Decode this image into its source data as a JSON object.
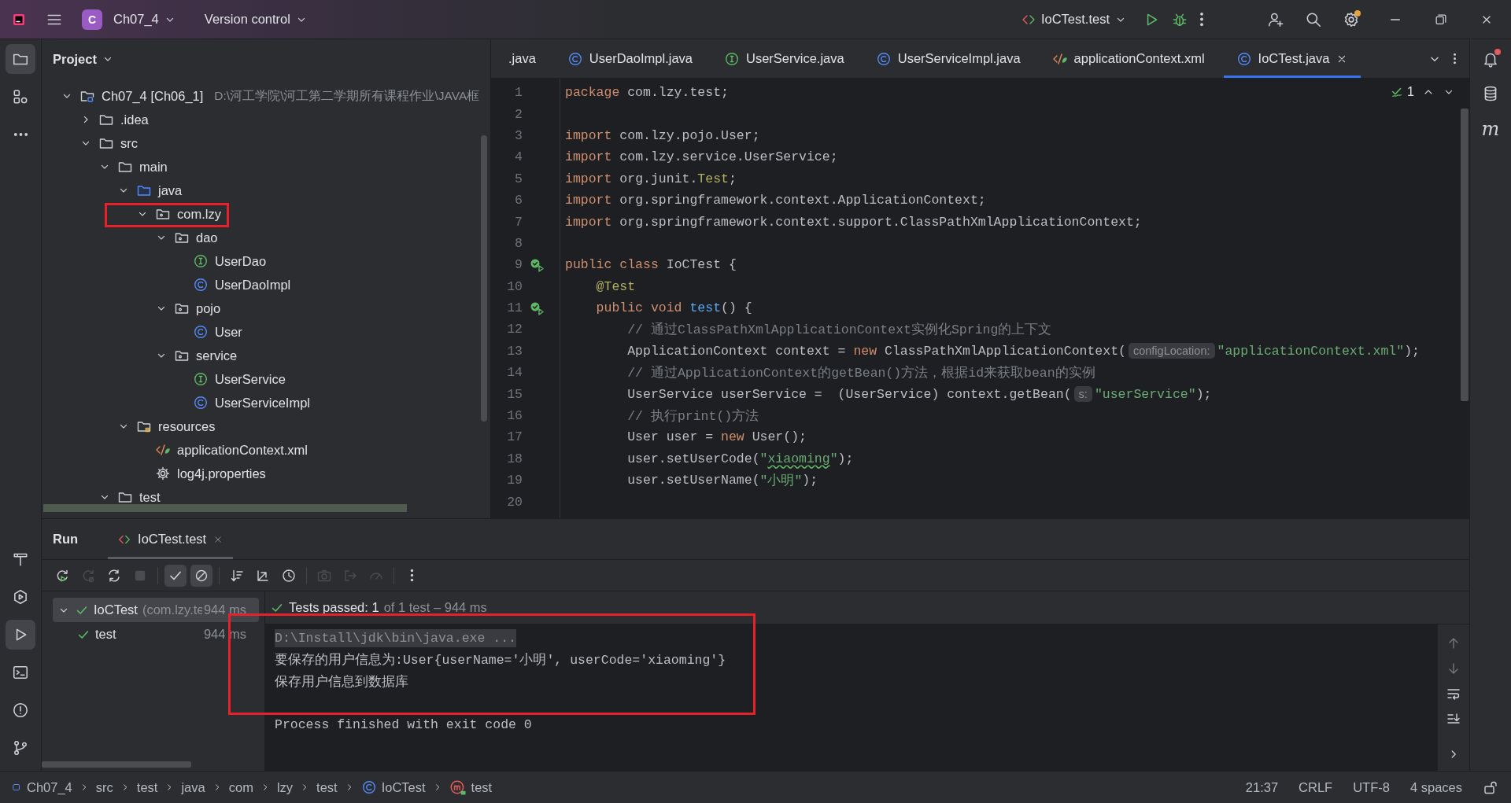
{
  "title_bar": {
    "project_badge": "C",
    "project": "Ch07_4",
    "vcs": "Version control",
    "run_config": "IoCTest.test",
    "settings_update": true
  },
  "left_toolbar": {
    "top_buttons": [
      {
        "selected": true
      },
      {
        "selected": false
      },
      {
        "selected": false
      }
    ],
    "bottom_buttons": [
      {
        "selected": false
      },
      {
        "selected": false
      },
      {
        "selected": true
      },
      {
        "selected": false
      },
      {
        "selected": false
      },
      {
        "selected": false
      }
    ]
  },
  "right_toolbar": {
    "notifications_unread": true,
    "maven_label": "m"
  },
  "project_panel": {
    "title": "Project",
    "tree": [
      {
        "label": "Ch07_4 [Ch06_1]",
        "path": "D:\\河工学院\\河工第二学期所有课程作业\\JAVA框",
        "kind": "module",
        "expanded": true,
        "highlighted": false,
        "children": [
          {
            "label": ".idea",
            "kind": "folder",
            "expanded": false,
            "highlighted": false
          },
          {
            "label": "src",
            "kind": "folder",
            "expanded": true,
            "highlighted": false,
            "children": [
              {
                "label": "main",
                "kind": "folder",
                "expanded": true,
                "highlighted": false,
                "children": [
                  {
                    "label": "java",
                    "kind": "source",
                    "expanded": true,
                    "highlighted": false,
                    "children": [
                      {
                        "label": "com.lzy",
                        "kind": "package",
                        "expanded": true,
                        "highlighted": true,
                        "children": [
                          {
                            "label": "dao",
                            "kind": "package",
                            "expanded": true,
                            "highlighted": false,
                            "children": [
                              {
                                "label": "UserDao",
                                "kind": "interface",
                                "highlighted": false
                              },
                              {
                                "label": "UserDaoImpl",
                                "kind": "class",
                                "highlighted": false
                              }
                            ]
                          },
                          {
                            "label": "pojo",
                            "kind": "package",
                            "expanded": true,
                            "highlighted": false,
                            "children": [
                              {
                                "label": "User",
                                "kind": "class",
                                "highlighted": false
                              }
                            ]
                          },
                          {
                            "label": "service",
                            "kind": "package",
                            "expanded": true,
                            "highlighted": false,
                            "children": [
                              {
                                "label": "UserService",
                                "kind": "interface",
                                "highlighted": false
                              },
                              {
                                "label": "UserServiceImpl",
                                "kind": "class",
                                "highlighted": false
                              }
                            ]
                          }
                        ]
                      }
                    ]
                  },
                  {
                    "label": "resources",
                    "kind": "resources",
                    "expanded": true,
                    "highlighted": false,
                    "children": [
                      {
                        "label": "applicationContext.xml",
                        "kind": "xml",
                        "highlighted": false
                      },
                      {
                        "label": "log4j.properties",
                        "kind": "properties",
                        "highlighted": false
                      }
                    ]
                  }
                ]
              },
              {
                "label": "test",
                "kind": "folder",
                "expanded": true,
                "highlighted": false
              }
            ]
          }
        ]
      }
    ]
  },
  "editor": {
    "tabs": [
      {
        "label": ".java",
        "kind": "none",
        "selected": false
      },
      {
        "label": "UserDaoImpl.java",
        "kind": "class",
        "selected": false
      },
      {
        "label": "UserService.java",
        "kind": "interface",
        "selected": false
      },
      {
        "label": "UserServiceImpl.java",
        "kind": "class",
        "selected": false
      },
      {
        "label": "applicationContext.xml",
        "kind": "xml",
        "selected": false
      },
      {
        "label": "IoCTest.java",
        "kind": "class",
        "selected": true
      }
    ],
    "inspection_count": "1",
    "lines": [
      {
        "number": "1",
        "run_marker": false,
        "tokens": [
          {
            "kind": "keyword",
            "text": "package"
          },
          {
            "kind": "plain",
            "text": " com.lzy.test;"
          }
        ]
      },
      {
        "number": "2",
        "run_marker": false
      },
      {
        "number": "3",
        "run_marker": false,
        "tokens": [
          {
            "kind": "keyword",
            "text": "import"
          },
          {
            "kind": "plain",
            "text": " com.lzy.pojo.User;"
          }
        ]
      },
      {
        "number": "4",
        "run_marker": false,
        "tokens": [
          {
            "kind": "keyword",
            "text": "import"
          },
          {
            "kind": "plain",
            "text": " com.lzy.service.UserService;"
          }
        ]
      },
      {
        "number": "5",
        "run_marker": false,
        "tokens": [
          {
            "kind": "keyword",
            "text": "import"
          },
          {
            "kind": "plain",
            "text": " org.junit."
          },
          {
            "kind": "annotation",
            "text": "Test"
          },
          {
            "kind": "plain",
            "text": ";"
          }
        ]
      },
      {
        "number": "6",
        "run_marker": false,
        "tokens": [
          {
            "kind": "keyword",
            "text": "import"
          },
          {
            "kind": "plain",
            "text": " org.springframework.context.ApplicationContext;"
          }
        ]
      },
      {
        "number": "7",
        "run_marker": false,
        "tokens": [
          {
            "kind": "keyword",
            "text": "import"
          },
          {
            "kind": "plain",
            "text": " org.springframework.context.support.ClassPathXmlApplicationContext;"
          }
        ]
      },
      {
        "number": "8",
        "run_marker": false
      },
      {
        "number": "9",
        "run_marker": true,
        "tokens": [
          {
            "kind": "keyword",
            "text": "public class"
          },
          {
            "kind": "plain",
            "text": " IoCTest {"
          }
        ]
      },
      {
        "number": "10",
        "run_marker": false,
        "tokens": [
          {
            "kind": "annotation",
            "text": "    @Test"
          }
        ]
      },
      {
        "number": "11",
        "run_marker": true,
        "tokens": [
          {
            "kind": "keyword",
            "text": "    public void "
          },
          {
            "kind": "method",
            "text": "test"
          },
          {
            "kind": "plain",
            "text": "() {"
          }
        ]
      },
      {
        "number": "12",
        "run_marker": false,
        "tokens": [
          {
            "kind": "comment",
            "text": "        // 通过ClassPathXmlApplicationContext实例化Spring的上下文"
          }
        ]
      },
      {
        "number": "13",
        "run_marker": false,
        "tokens": [
          {
            "kind": "plain",
            "text": "        ApplicationContext context = "
          },
          {
            "kind": "keyword",
            "text": "new"
          },
          {
            "kind": "plain",
            "text": " ClassPathXmlApplicationContext("
          },
          {
            "kind": "hint",
            "text": "configLocation:"
          },
          {
            "kind": "string",
            "text": "\"applicationContext.xml\""
          },
          {
            "kind": "plain",
            "text": ");"
          }
        ]
      },
      {
        "number": "14",
        "run_marker": false,
        "tokens": [
          {
            "kind": "comment",
            "text": "        // 通过ApplicationContext的getBean()方法，根据id来获取bean的实例"
          }
        ]
      },
      {
        "number": "15",
        "run_marker": false,
        "tokens": [
          {
            "kind": "plain",
            "text": "        UserService userService =  (UserService) context.getBean("
          },
          {
            "kind": "hint",
            "text": "s:"
          },
          {
            "kind": "string",
            "text": "\"userService\""
          },
          {
            "kind": "plain",
            "text": ");"
          }
        ]
      },
      {
        "number": "16",
        "run_marker": false,
        "tokens": [
          {
            "kind": "comment",
            "text": "        // 执行print()方法"
          }
        ]
      },
      {
        "number": "17",
        "run_marker": false,
        "tokens": [
          {
            "kind": "plain",
            "text": "        User user = "
          },
          {
            "kind": "keyword",
            "text": "new"
          },
          {
            "kind": "plain",
            "text": " User();"
          }
        ]
      },
      {
        "number": "18",
        "run_marker": false,
        "tokens": [
          {
            "kind": "plain",
            "text": "        user.setUserCode("
          },
          {
            "kind": "string",
            "text": "\""
          },
          {
            "kind": "string_warning",
            "text": "xiaoming"
          },
          {
            "kind": "string",
            "text": "\""
          },
          {
            "kind": "plain",
            "text": ");"
          }
        ]
      },
      {
        "number": "19",
        "run_marker": false,
        "tokens": [
          {
            "kind": "plain",
            "text": "        user.setUserName("
          },
          {
            "kind": "string",
            "text": "\"小明\""
          },
          {
            "kind": "plain",
            "text": ");"
          }
        ]
      },
      {
        "number": "20",
        "run_marker": false
      }
    ]
  },
  "run_panel": {
    "title": "Run",
    "tabs": [
      {
        "label": "IoCTest.test",
        "selected": true
      }
    ],
    "toolbar": [
      {
        "disabled": false,
        "toggled": false
      },
      {
        "disabled": true,
        "toggled": false
      },
      {
        "disabled": false,
        "toggled": false
      },
      {
        "disabled": true,
        "toggled": false
      },
      {
        "disabled": false,
        "toggled": true
      },
      {
        "disabled": false,
        "toggled": true
      },
      {
        "disabled": false,
        "toggled": false
      },
      {
        "disabled": false,
        "toggled": false
      },
      {
        "disabled": false,
        "toggled": false
      },
      {
        "disabled": true,
        "toggled": false
      },
      {
        "disabled": true,
        "toggled": false
      },
      {
        "disabled": true,
        "toggled": false
      },
      {
        "disabled": false,
        "toggled": false
      }
    ],
    "test_tree": [
      {
        "name": "IoCTest",
        "package": "(com.lzy.te",
        "time": "944 ms",
        "passed": true,
        "selected": true,
        "expanded": true,
        "children": [
          {
            "name": "test",
            "time": "944 ms",
            "passed": true,
            "selected": false
          }
        ]
      }
    ],
    "summary": {
      "status": "Tests passed: 1",
      "detail": "of 1 test – 944 ms"
    },
    "console": {
      "highlighted": true,
      "lines": [
        {
          "kind": "command",
          "text": "D:\\Install\\jdk\\bin\\java.exe ..."
        },
        {
          "kind": "output",
          "text": "要保存的用户信息为:User{userName='小明', userCode='xiaoming'}"
        },
        {
          "kind": "output",
          "text": "保存用户信息到数据库"
        },
        {
          "kind": "exit",
          "text": "Process finished with exit code 0"
        }
      ]
    },
    "console_toolbar": [
      {
        "disabled": true
      },
      {
        "disabled": true
      },
      {
        "disabled": false
      },
      {
        "disabled": false
      }
    ]
  },
  "status_bar": {
    "breadcrumbs": [
      {
        "label": "Ch07_4",
        "kind": "module"
      },
      {
        "label": "src",
        "kind": "plain"
      },
      {
        "label": "test",
        "kind": "plain"
      },
      {
        "label": "java",
        "kind": "plain"
      },
      {
        "label": "com",
        "kind": "plain"
      },
      {
        "label": "lzy",
        "kind": "plain"
      },
      {
        "label": "test",
        "kind": "plain"
      },
      {
        "label": "IoCTest",
        "kind": "class"
      },
      {
        "label": "test",
        "kind": "method"
      }
    ],
    "position": "21:37",
    "line_separator": "CRLF",
    "encoding": "UTF-8",
    "indent": "4 spaces",
    "locked": false
  }
}
